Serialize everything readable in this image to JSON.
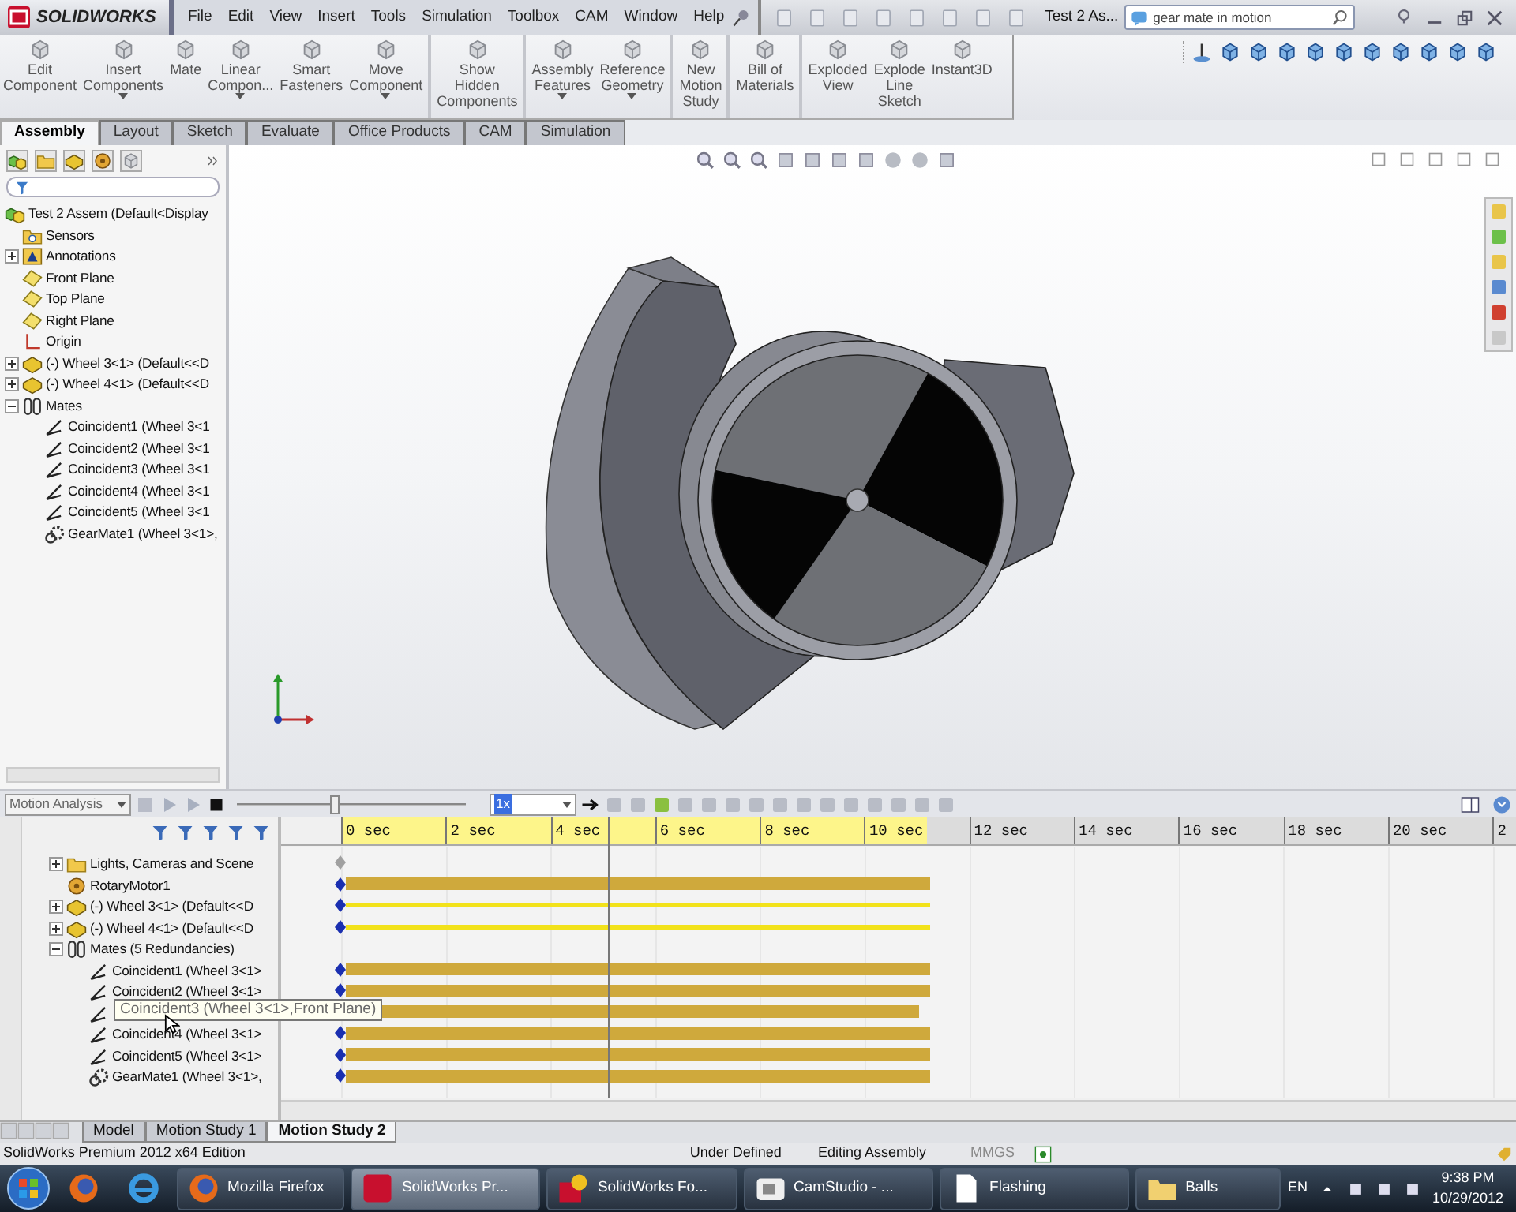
{
  "app": {
    "logo": "SOLIDWORKS"
  },
  "menu": [
    "File",
    "Edit",
    "View",
    "Insert",
    "Tools",
    "Simulation",
    "Toolbox",
    "CAM",
    "Window",
    "Help"
  ],
  "document": {
    "title": "Test 2 As..."
  },
  "search": {
    "value": "gear mate in motion"
  },
  "ribbon": [
    {
      "label": "Edit\nComponent",
      "dropdown": false,
      "separator_before": false
    },
    {
      "label": "Insert\nComponents",
      "dropdown": true,
      "separator_before": false
    },
    {
      "label": "Mate",
      "dropdown": false,
      "separator_before": false
    },
    {
      "label": "Linear\nCompon...",
      "dropdown": true,
      "separator_before": false
    },
    {
      "label": "Smart\nFasteners",
      "dropdown": false,
      "separator_before": false
    },
    {
      "label": "Move\nComponent",
      "dropdown": true,
      "separator_before": false
    },
    {
      "label": "Show\nHidden\nComponents",
      "dropdown": false,
      "separator_before": true
    },
    {
      "label": "Assembly\nFeatures",
      "dropdown": true,
      "separator_before": true
    },
    {
      "label": "Reference\nGeometry",
      "dropdown": true,
      "separator_before": false
    },
    {
      "label": "New\nMotion\nStudy",
      "dropdown": false,
      "separator_before": true
    },
    {
      "label": "Bill of\nMaterials",
      "dropdown": false,
      "separator_before": true
    },
    {
      "label": "Exploded\nView",
      "dropdown": false,
      "separator_before": true
    },
    {
      "label": "Explode\nLine\nSketch",
      "dropdown": false,
      "separator_before": false
    },
    {
      "label": "Instant3D",
      "dropdown": false,
      "separator_before": false
    }
  ],
  "tabs": [
    {
      "label": "Assembly",
      "selected": true
    },
    {
      "label": "Layout",
      "selected": false
    },
    {
      "label": "Sketch",
      "selected": false
    },
    {
      "label": "Evaluate",
      "selected": false
    },
    {
      "label": "Office Products",
      "selected": false
    },
    {
      "label": "CAM",
      "selected": false
    },
    {
      "label": "Simulation",
      "selected": false
    }
  ],
  "feature_tree": {
    "label": "Test 2 Assem (Default<Display",
    "kind": "assembly",
    "children": [
      {
        "label": "Sensors",
        "kind": "sensor"
      },
      {
        "label": "Annotations",
        "kind": "annotation",
        "expanded": false
      },
      {
        "label": "Front Plane",
        "kind": "plane"
      },
      {
        "label": "Top Plane",
        "kind": "plane"
      },
      {
        "label": "Right Plane",
        "kind": "plane"
      },
      {
        "label": "Origin",
        "kind": "origin"
      },
      {
        "label": "(-) Wheel 3<1> (Default<<D",
        "kind": "part",
        "expanded": false
      },
      {
        "label": "(-) Wheel 4<1> (Default<<D",
        "kind": "part",
        "expanded": false
      },
      {
        "label": "Mates",
        "kind": "mates",
        "expanded": true,
        "children": [
          {
            "label": "Coincident1 (Wheel 3<1",
            "kind": "coincident"
          },
          {
            "label": "Coincident2 (Wheel 3<1",
            "kind": "coincident"
          },
          {
            "label": "Coincident3 (Wheel 3<1",
            "kind": "coincident"
          },
          {
            "label": "Coincident4 (Wheel 3<1",
            "kind": "coincident"
          },
          {
            "label": "Coincident5 (Wheel 3<1",
            "kind": "coincident"
          },
          {
            "label": "GearMate1 (Wheel 3<1>,",
            "kind": "gear"
          }
        ]
      }
    ]
  },
  "motion_study": {
    "type": "Motion Analysis",
    "speed": "1x",
    "time_slider": {
      "level": 0.43
    },
    "ticks": [
      "0 sec",
      "2 sec",
      "4 sec",
      "6 sec",
      "8 sec",
      "10 sec",
      "12 sec",
      "14 sec",
      "16 sec",
      "18 sec",
      "20 sec",
      "2"
    ],
    "playhead": {
      "level": 0.265
    },
    "items": [
      {
        "label": "Lights, Cameras and Scene",
        "kind": "folder",
        "expanded": false,
        "keyframe": true,
        "bar": false,
        "line": false
      },
      {
        "label": "RotaryMotor1",
        "kind": "motor",
        "keyframe": true,
        "bar": true,
        "line": false
      },
      {
        "label": "(-) Wheel 3<1> (Default<<D",
        "kind": "part",
        "expanded": false,
        "keyframe": true,
        "bar": false,
        "line": true
      },
      {
        "label": "(-) Wheel 4<1> (Default<<D",
        "kind": "part",
        "expanded": false,
        "keyframe": true,
        "bar": false,
        "line": true
      },
      {
        "label": "Mates (5 Redundancies)",
        "kind": "mates",
        "expanded": true,
        "keyframe": false,
        "bar": false,
        "line": false,
        "children": [
          {
            "label": "Coincident1 (Wheel 3<1>",
            "kind": "coincident",
            "keyframe": true,
            "bar": true,
            "line": false
          },
          {
            "label": "Coincident2 (Wheel 3<1>",
            "kind": "coincident",
            "keyframe": true,
            "bar": true,
            "line": false
          },
          {
            "kind": "coincident",
            "keyframe": false,
            "bar": true,
            "line": false
          },
          {
            "label": "Coincident4 (Wheel 3<1>",
            "kind": "coincident",
            "keyframe": true,
            "bar": true,
            "line": false
          },
          {
            "label": "Coincident5 (Wheel 3<1>",
            "kind": "coincident",
            "keyframe": true,
            "bar": true,
            "line": false
          },
          {
            "label": "GearMate1 (Wheel 3<1>,",
            "kind": "gear",
            "keyframe": true,
            "bar": true,
            "line": false
          }
        ]
      }
    ],
    "tooltip": "Coincident3 (Wheel 3<1>,Front Plane)"
  },
  "study_tabs": [
    {
      "label": "Model",
      "selected": false
    },
    {
      "label": "Motion Study 1",
      "selected": false
    },
    {
      "label": "Motion Study 2",
      "selected": true
    }
  ],
  "status_bar": {
    "edition": "SolidWorks Premium 2012 x64 Edition",
    "state": "Under Defined",
    "mode": "Editing Assembly",
    "units": "MMGS"
  },
  "taskbar": {
    "items": [
      {
        "kind": "firefox"
      },
      {
        "kind": "explorer"
      },
      {
        "label": "Mozilla Firefox",
        "kind": "firefox",
        "selected": false
      },
      {
        "label": "SolidWorks Pr...",
        "kind": "solidworks",
        "selected": true
      },
      {
        "label": "SolidWorks Fo...",
        "kind": "help",
        "selected": false
      },
      {
        "label": "CamStudio - ...",
        "kind": "camera",
        "selected": false
      },
      {
        "label": "Flashing",
        "kind": "document",
        "selected": false
      },
      {
        "label": "Balls",
        "kind": "folder",
        "selected": false
      }
    ],
    "language": "EN",
    "time": "9:38 PM",
    "date": "10/29/2012"
  }
}
